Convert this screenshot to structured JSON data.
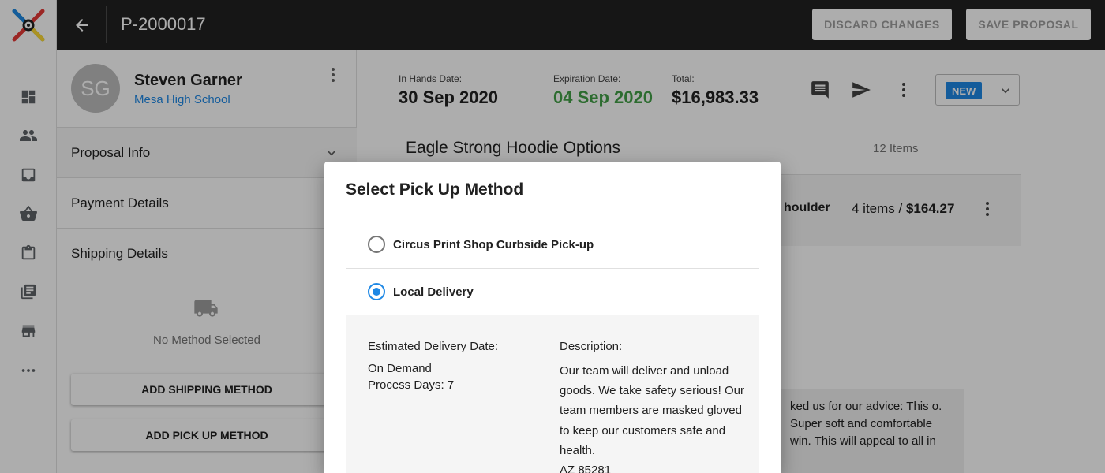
{
  "app": {
    "proposal_id": "P-2000017",
    "actions": {
      "discard": "DISCARD CHANGES",
      "save": "SAVE PROPOSAL"
    }
  },
  "nav_icons": [
    "dashboard-icon",
    "people-icon",
    "inbox-icon",
    "basket-icon",
    "clipboard-icon",
    "library-books-icon",
    "store-icon",
    "more-horizontal-icon"
  ],
  "customer": {
    "initials": "SG",
    "name": "Steven Garner",
    "organization": "Mesa High School"
  },
  "sections": {
    "proposal_info": "Proposal Info",
    "payment_details": "Payment Details",
    "shipping_details": "Shipping Details"
  },
  "shipping": {
    "empty_text": "No Method Selected",
    "add_shipping": "ADD SHIPPING METHOD",
    "add_pickup": "ADD PICK UP METHOD"
  },
  "summary": {
    "in_hands_label": "In Hands Date:",
    "in_hands_value": "30 Sep 2020",
    "expiration_label": "Expiration Date:",
    "expiration_value": "04 Sep 2020",
    "total_label": "Total:",
    "total_value": "$16,983.33",
    "status": "NEW"
  },
  "group": {
    "title": "Eagle Strong Hoodie Options",
    "count": "12 Items",
    "item_name_fragment": "houlder",
    "item_qty": "4 items / ",
    "item_price": "$164.27",
    "note_text": "ked us for our advice: This o. Super soft and comfortable win. This will appeal to all in"
  },
  "modal": {
    "title": "Select Pick Up Method",
    "option1": {
      "label": "Circus Print Shop Curbside Pick-up",
      "selected": false
    },
    "option2": {
      "label": "Local Delivery",
      "selected": true,
      "est_label": "Estimated Delivery Date:",
      "est_line1": "On Demand",
      "est_line2": "Process Days: 7",
      "desc_label": "Description:",
      "desc_text": "Our team will deliver and unload goods. We take safety serious! Our team members are masked gloved to keep our customers safe and health.",
      "desc_zip": "AZ 85281"
    }
  },
  "colors": {
    "topbar": "#212121",
    "accent_blue": "#1e88e5",
    "green": "#43a047"
  }
}
